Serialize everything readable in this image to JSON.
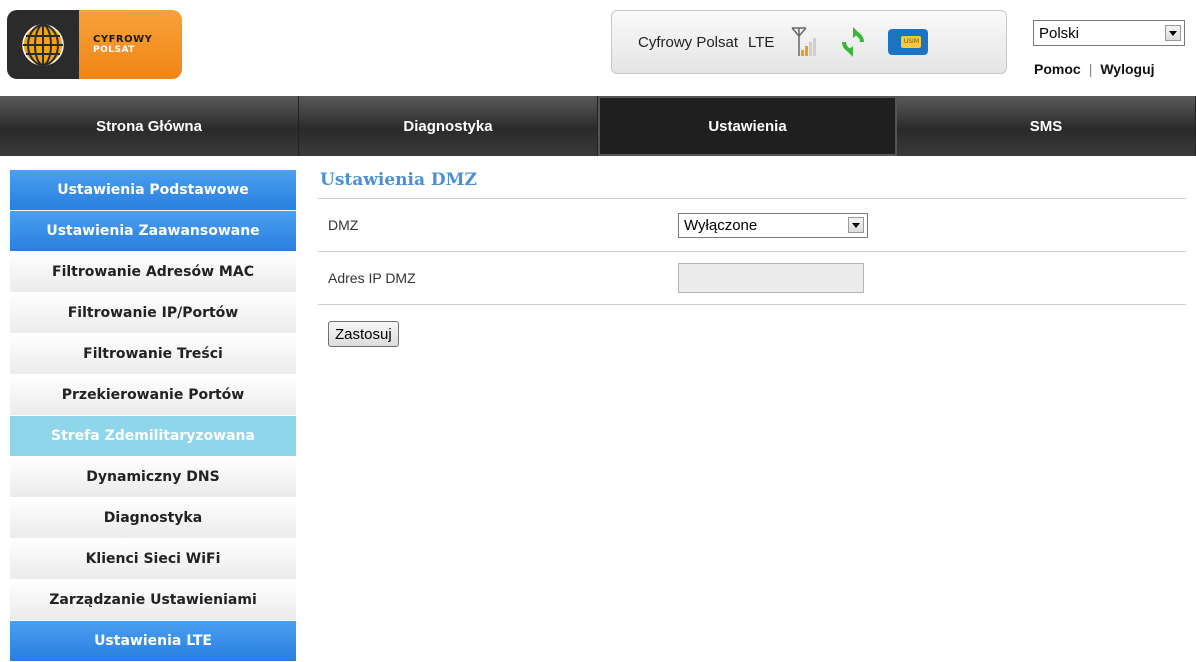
{
  "header": {
    "logo": {
      "line1": "CYFROWY",
      "line2": "POLSAT"
    },
    "status": {
      "operator": "Cyfrowy Polsat",
      "network": "LTE",
      "usim_label": "USIM"
    },
    "language": {
      "selected": "Polski"
    },
    "links": {
      "help": "Pomoc",
      "separator": "|",
      "logout": "Wyloguj"
    }
  },
  "nav": {
    "tabs": [
      {
        "label": "Strona Główna"
      },
      {
        "label": "Diagnostyka"
      },
      {
        "label": "Ustawienia",
        "active": true
      },
      {
        "label": "SMS"
      }
    ]
  },
  "sidebar": {
    "items": [
      {
        "label": "Ustawienia Podstawowe"
      },
      {
        "label": "Ustawienia Zaawansowane"
      },
      {
        "label": "Filtrowanie Adresów MAC"
      },
      {
        "label": "Filtrowanie IP/Portów"
      },
      {
        "label": "Filtrowanie Treści"
      },
      {
        "label": "Przekierowanie Portów"
      },
      {
        "label": "Strefa Zdemilitaryzowana",
        "selected": true
      },
      {
        "label": "Dynamiczny DNS"
      },
      {
        "label": "Diagnostyka"
      },
      {
        "label": "Klienci Sieci WiFi"
      },
      {
        "label": "Zarządzanie Ustawieniami"
      },
      {
        "label": "Ustawienia LTE"
      }
    ]
  },
  "content": {
    "title": "Ustawienia DMZ",
    "dmz": {
      "label": "DMZ",
      "value": "Wyłączone"
    },
    "ip": {
      "label": "Adres IP DMZ",
      "value": ""
    },
    "apply_label": "Zastosuj"
  },
  "colors": {
    "accent_blue": "#2a7ee0",
    "selected_cyan": "#8fd6ea",
    "title_blue": "#4a90d9",
    "logo_orange": "#f08515"
  }
}
